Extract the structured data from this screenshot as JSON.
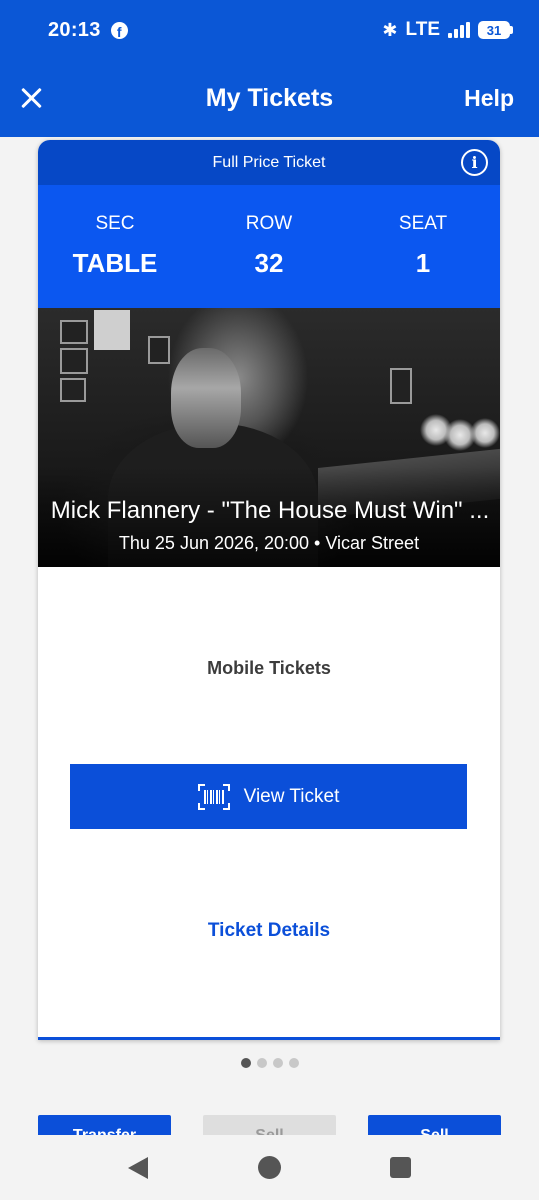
{
  "status_bar": {
    "time": "20:13",
    "facebook_icon": "f",
    "bluetooth_icon": "✱",
    "network": "LTE",
    "battery_level": "31"
  },
  "app_bar": {
    "title": "My Tickets",
    "help_label": "Help"
  },
  "ticket": {
    "type_label": "Full Price Ticket",
    "info_icon": "i",
    "section": {
      "label": "SEC",
      "value": "TABLE"
    },
    "row": {
      "label": "ROW",
      "value": "32"
    },
    "seat": {
      "label": "SEAT",
      "value": "1"
    },
    "event_name": "Mick Flannery - \"The House Must Win\" ...",
    "event_meta": "Thu 25 Jun 2026, 20:00 • Vicar Street",
    "delivery_label": "Mobile Tickets",
    "view_ticket_label": "View Ticket",
    "details_link": "Ticket Details"
  },
  "pager": {
    "total": 4,
    "active_index": 0
  },
  "actions": {
    "left_label": "Transfer",
    "middle_label": "Sell",
    "right_label": "Sell"
  },
  "colors": {
    "brand_blue": "#0b57d6",
    "seat_bar_blue": "#0b57f0",
    "link_blue": "#0b4fd9"
  }
}
